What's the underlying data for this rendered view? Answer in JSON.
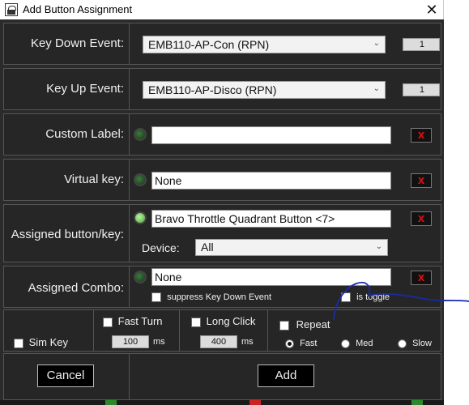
{
  "window": {
    "title": "Add Button Assignment",
    "close_glyph": "✕"
  },
  "key_down": {
    "label": "Key Down Event:",
    "event": "EMB110-AP-Con (RPN)",
    "value": "1"
  },
  "key_up": {
    "label": "Key Up Event:",
    "event": "EMB110-AP-Disco (RPN)",
    "value": "1"
  },
  "custom_label": {
    "label": "Custom Label:",
    "value": "",
    "clear": "x"
  },
  "virtual_key": {
    "label": "Virtual key:",
    "value": "None",
    "clear": "x"
  },
  "assigned_button": {
    "label": "Assigned button/key:",
    "value": "Bravo Throttle Quadrant Button <7>",
    "clear": "x",
    "device_label": "Device:",
    "device_value": "All"
  },
  "assigned_combo": {
    "label": "Assigned Combo:",
    "value": "None",
    "clear": "x",
    "suppress_label": "suppress Key Down Event",
    "is_toggle_label": "is toggle"
  },
  "options": {
    "sim_key": "Sim Key",
    "fast_turn": "Fast Turn",
    "fast_turn_value": "100",
    "long_click": "Long Click",
    "long_click_value": "400",
    "ms": "ms",
    "repeat": "Repeat",
    "speeds": [
      "Fast",
      "Med",
      "Slow"
    ],
    "selected_speed": "Fast"
  },
  "buttons": {
    "cancel": "Cancel",
    "add": "Add"
  },
  "colors": {
    "annotation_stroke": "#1a2aa8",
    "clear_x": "#dd1111",
    "led_on": "#8ad66f"
  }
}
